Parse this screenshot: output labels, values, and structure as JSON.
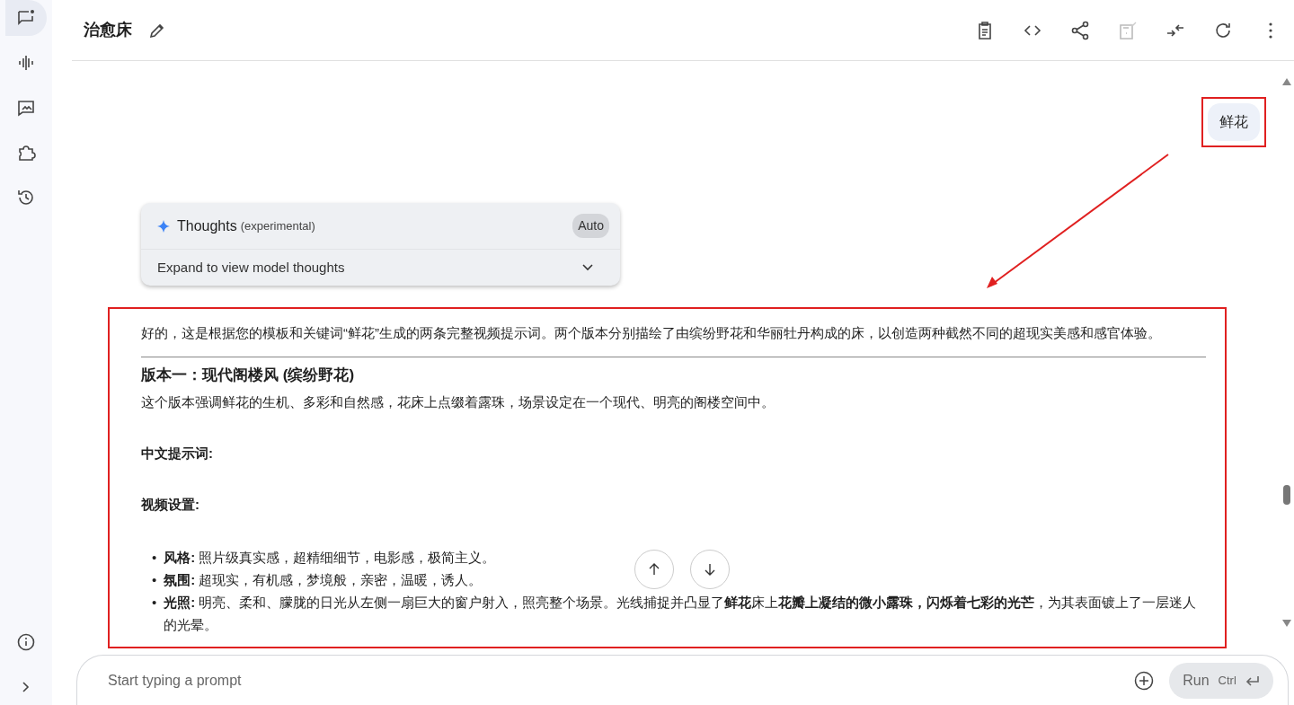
{
  "sidebar": {
    "items": [
      {
        "kind": "chat",
        "selected": true
      },
      {
        "kind": "audio",
        "selected": false
      },
      {
        "kind": "image",
        "selected": false
      },
      {
        "kind": "puzzle",
        "selected": false
      },
      {
        "kind": "history",
        "selected": false
      }
    ]
  },
  "header": {
    "title": "治愈床"
  },
  "user_message": {
    "text": "鲜花"
  },
  "thoughts": {
    "title": "Thoughts",
    "tag": "(experimental)",
    "mode": "Auto",
    "expand_label": "Expand to view model thoughts"
  },
  "response": {
    "intro": "好的，这是根据您的模板和关键词“鲜花”生成的两条完整视频提示词。两个版本分别描绘了由缤纷野花和华丽牡丹构成的床，以创造两种截然不同的超现实美感和感官体验。",
    "heading": "版本一：现代阁楼风 (缤纷野花)",
    "description": "这个版本强调鲜花的生机、多彩和自然感，花床上点缀着露珠，场景设定在一个现代、明亮的阁楼空间中。",
    "labels": [
      "中文提示词:",
      "视频设置:"
    ],
    "bullets": [
      {
        "marker": "•",
        "label": "风格:",
        "text": "照片级真实感，超精细细节，电影感，极简主义。"
      },
      {
        "marker": "•",
        "label": "氛围:",
        "text": "超现实，有机感，梦境般，亲密，温暖，诱人。"
      },
      {
        "marker": "•",
        "label": "光照:",
        "text": "明亮、柔和、朦胧的日光从左侧一扇巨大的窗户射入，照亮整个场景。光线捕捉并凸显了**鲜花**床上**花瓣上凝结的微小露珠，闪烁着七彩的光芒**，为其表面镀上了一层迷人的光晕。"
      }
    ]
  },
  "prompt": {
    "placeholder": "Start typing a prompt",
    "run_label": "Run",
    "shortcut": "Ctrl"
  }
}
